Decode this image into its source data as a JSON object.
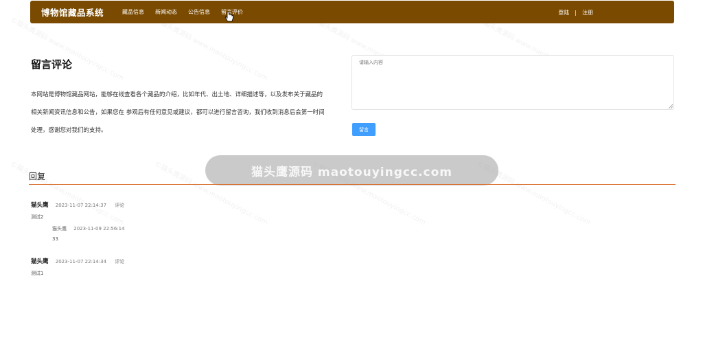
{
  "navbar": {
    "brand": "博物馆藏品系统",
    "links": [
      "藏品信息",
      "新闻动态",
      "公告信息",
      "留言评价"
    ],
    "login": "登陆",
    "separator": "|",
    "register": "注册"
  },
  "intro": {
    "title": "留言评论",
    "text": "本网站是博物馆藏品网站，能够在线查看各个藏品的介绍，比如年代、出土地、详细描述等，以及发布关于藏品的相关新闻资讯信息和公告，如果您在 参观后有任何意见或建议，都可以进行留言咨询，我们收到消息后会第一时间处理，感谢您对我们的支持。"
  },
  "form": {
    "placeholder": "请输入内容",
    "submit_label": "留言"
  },
  "watermark": {
    "banner": "猫头鹰源码 maotouyingcc.com",
    "tile": "©猫头鹰源码 www.maotouyingcc.com"
  },
  "reply": {
    "title": "回复",
    "comments": [
      {
        "user": "猫头鹰",
        "time": "2023-11-07 22:14:37",
        "action": "评论",
        "content": "测试2",
        "replies": [
          {
            "user": "猫头鹰",
            "time": "2023-11-09 22:56:14",
            "content": "33"
          }
        ]
      },
      {
        "user": "猫头鹰",
        "time": "2023-11-07 22:14:34",
        "action": "评论",
        "content": "测试1",
        "replies": []
      }
    ]
  },
  "colors": {
    "navbar": "#7a4a00",
    "accent": "#409eff",
    "divider": "#d66b2a"
  }
}
